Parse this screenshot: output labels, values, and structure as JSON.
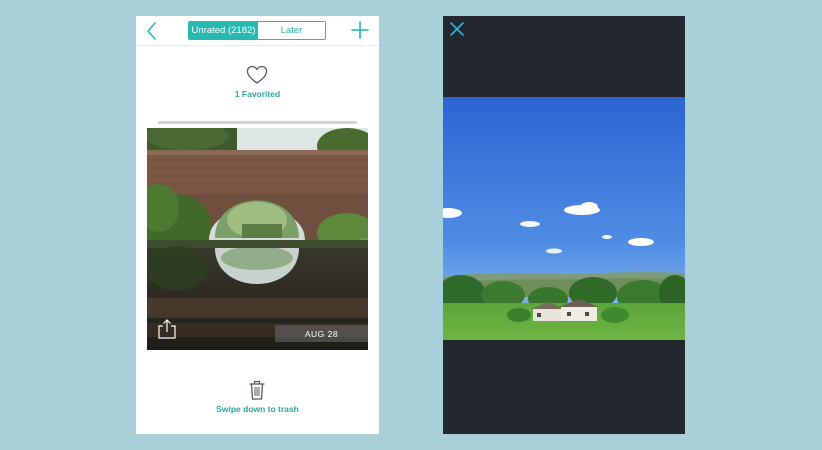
{
  "left_screen": {
    "header": {
      "back_icon": "chevron-left-icon",
      "tabs": [
        {
          "label": "Unrated (2182)",
          "active": true
        },
        {
          "label": "Later",
          "active": false
        }
      ],
      "add_icon": "plus-icon"
    },
    "favorites": {
      "icon": "heart-icon",
      "label": "1 Favorited"
    },
    "photo": {
      "subject": "stone bridge over canal with reflection",
      "date": "AUG 28",
      "share_icon": "share-icon"
    },
    "trash": {
      "icon": "trash-icon",
      "label": "Swipe down to trash"
    }
  },
  "right_screen": {
    "close_icon": "close-icon",
    "photo": {
      "subject": "countryside landscape with houses and blue sky"
    }
  },
  "colors": {
    "background": "#a9cfd9",
    "accent": "#27b8b0",
    "label": "#2aa89c",
    "dark_panel": "#23272e"
  }
}
